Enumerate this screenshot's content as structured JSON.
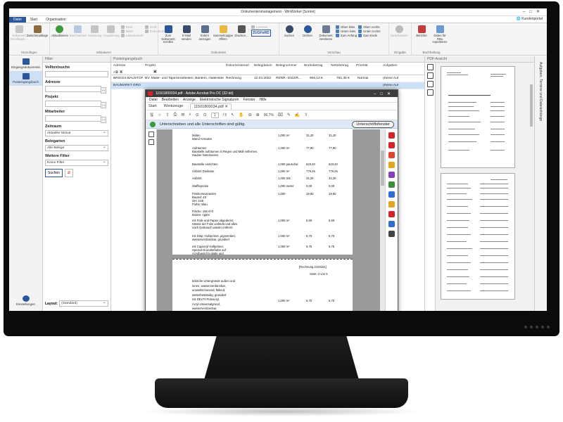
{
  "app": {
    "title": "Dokumentenmanagement - WinWorker [Sonne]",
    "portal": "Kundenportal"
  },
  "tabs": [
    "Datei",
    "Start",
    "Organisation"
  ],
  "ribbon": {
    "groups": [
      {
        "label": "Hinzufügen",
        "buttons": [
          "Dokument hinzufügen...",
          "Zwischenablage"
        ]
      },
      {
        "label": "Miniaturen",
        "buttons": [
          "Aktualisieren",
          "Durchsuchen",
          "Sortierung",
          "Gruppierung"
        ],
        "small": [
          "Klein",
          "Mittel",
          "Listenansicht",
          "Groß",
          "Extra Groß"
        ]
      },
      {
        "label": "Dokument",
        "buttons": [
          "Zum Dokument scrollen",
          "E-Mail senden",
          "Extern anzeigen",
          "Sammelmappe öffnen",
          "Drucken..."
        ],
        "small": [
          "Löschen"
        ],
        "badge": "ZUGFeRD"
      },
      {
        "label": "Vorschau",
        "buttons": [
          "Suchen",
          "Drehen",
          "Dokument zentrieren"
        ],
        "small": [
          "Oben links",
          "Unten links",
          "Zum Anfang",
          "Oben rechts",
          "Unten rechts",
          "Zum Ende"
        ]
      },
      {
        "label": "Eingabe",
        "buttons": [
          "Zurücksetzen"
        ]
      },
      {
        "label": "Buchhaltung",
        "buttons": [
          "Berichte",
          "Daten für FiBu exportieren"
        ]
      }
    ]
  },
  "nav": {
    "items": [
      "Eingangsdokumente",
      "Posteingangsbuch"
    ],
    "settings": "Einstellungen"
  },
  "filter": {
    "header": "Filter",
    "fields": {
      "volltext": "Volltextsuche",
      "adresse": "Adresse",
      "projekt": "Projekt",
      "mitarbeiter": "Mitarbeiter",
      "zeitraum": "Zeitraum",
      "zeitraum_value": "Aktueller Monat",
      "belegarten": "Belegarten",
      "belegarten_value": "Alle Belege",
      "weitere": "Weitere Filter",
      "weitere_value": "Keine Filter"
    },
    "search_label": "Suchen",
    "layout_label": "Layout:",
    "layout_value": "(Standard)"
  },
  "grid": {
    "header": "Posteingangsbuch",
    "columns": [
      "Adresse",
      "Projekt",
      "Dokumentenart",
      "Belegdatum",
      "Belegnummer",
      "Bruttobetrag",
      "Nettobetrag",
      "Priorität",
      "Aufgaben"
    ],
    "rows": [
      [
        "BRIGGS BAUSTOFFH...",
        "BV: Maler- und Tapezierarbeiten, Baritem, Hallenstein, Barbara",
        "Rechnung",
        "12.04.2022",
        "RENR.-2022/R...",
        "906,13 €",
        "761,45 €",
        "Normal",
        "(Keine Auf"
      ],
      [
        "BAUMARKT GRO",
        "",
        "",
        "",
        "",
        "",
        "",
        "",
        "(Keine Auf"
      ]
    ]
  },
  "pdf_pane": {
    "header": "PDF-Ansicht",
    "side_tab": "Aufgaben, Termine und Dateianhänge"
  },
  "acrobat": {
    "title": "11501800034.pdf - Adobe Acrobat Pro DC (32-bit)",
    "menu": [
      "Datei",
      "Bearbeiten",
      "Anzeige",
      "Elektronische Signaturen",
      "Fenster",
      "Hilfe"
    ],
    "tabs": [
      "Start",
      "Werkzeuge",
      "11501800034.pdf"
    ],
    "page_current": "1",
    "page_total": "/ 5",
    "zoom": "96,7%",
    "signature_message": "Unterschrieben und alle Unterschriften sind gültig.",
    "signature_button": "Unterschriftsfenster",
    "page1_lines": [
      {
        "text": "Malen",
        "c": 0
      },
      {
        "text": "Wand Anmalen",
        "c": 0
      },
      {
        "text": "Aufräumen",
        "c": 0
      },
      {
        "text": "Baustelle aufräumen in Regen und Müll entfernen.",
        "c": 0
      },
      {
        "text": "Sauber hinterlassen.",
        "c": 0
      },
      {
        "text": "Baustelle einrichten",
        "c": 0
      },
      {
        "text": "Anfahrt Dreileiter",
        "c": 0
      },
      {
        "text": "Anfahrt",
        "c": 0
      },
      {
        "text": "Stafflepreise",
        "c": 0
      },
      {
        "text": "Positionsvarianten",
        "c": 0
      },
      {
        "text": "Bauteil:          4S",
        "c": 0
      },
      {
        "text": "OH:               1SE",
        "c": 0
      },
      {
        "text": "Farbe:            Blau",
        "c": 0
      },
      {
        "text": "Fläche:           156 m²2",
        "c": 0
      },
      {
        "text": "Boden:            rigitre",
        "c": 0
      },
      {
        "text": "mit Folie und Papier abgedeckt;",
        "c": 0
      },
      {
        "text": "Stösse der Folie verklebt und alles",
        "c": 0
      },
      {
        "text": "nach Gebrauch wieder entfernt",
        "c": 0
      },
      {
        "text": "mit Disp.-Holzprimer, pigmentiert,",
        "c": 0
      },
      {
        "text": "wasserverdünnbar, grundiert",
        "c": 0
      },
      {
        "text": "mit Capacryl Haftprimer,",
        "c": 0
      },
      {
        "text": "Spezial-Grundierfarbe auf",
        "c": 0
      },
      {
        "text": "Acrylbasis für glatte und",
        "c": 0
      }
    ],
    "page1_values": [
      {
        "q": "1,000 m²",
        "p": "31,20",
        "t": "31,20"
      },
      {
        "q": "1,000 m²",
        "p": "77,90",
        "t": "77,90"
      },
      {
        "q": "1,000 pauschal",
        "p": "623,40",
        "t": "623,40"
      },
      {
        "q": "1,000 m²",
        "p": "779,36",
        "t": "779,36"
      },
      {
        "q": "1,000 Stk",
        "p": "31,20",
        "t": "31,20"
      },
      {
        "q": "1,000 meter",
        "p": "0,00",
        "t": "0,00"
      },
      {
        "q": "1,000",
        "p": "19,60",
        "t": "19,60"
      },
      {
        "q": "1,000 m²",
        "p": "5,90",
        "t": "5,90"
      },
      {
        "q": "1,000 m²",
        "p": "6,75",
        "t": "6,75"
      },
      {
        "q": "1,000 m²",
        "p": "6,75",
        "t": "6,75"
      }
    ],
    "page2_header": "[Rechnung 2103101]",
    "page2_page": "Seite: 2 von 5",
    "page2_lines": [
      "kritische Untergründe außen und",
      "innen, wasserverdünnbar,",
      "umweltschonend, füllend,",
      "wetterbeständig, grundiert",
      "mit DELTA Primacryl,",
      "Acryl-Universalgrund,",
      "wasserverdünnbar,",
      "umweltschonend, für innen und"
    ],
    "page2_values": {
      "q": "1,000 m²",
      "p": "6,70",
      "t": "6,70"
    }
  }
}
